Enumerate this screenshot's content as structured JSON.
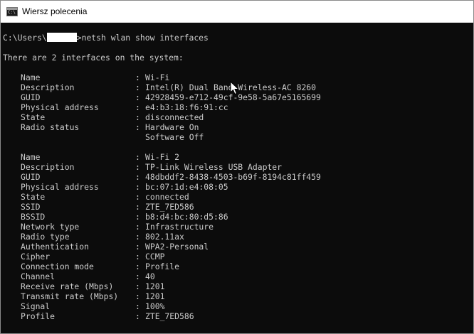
{
  "window": {
    "title": "Wiersz polecenia"
  },
  "prompt": {
    "prefix": "C:\\Users\\",
    "suffix": ">netsh wlan show interfaces"
  },
  "summary": "There are 2 interfaces on the system:",
  "interfaces": [
    {
      "rows": [
        {
          "key": "Name",
          "value": "Wi-Fi"
        },
        {
          "key": "Description",
          "value": "Intel(R) Dual Band Wireless-AC 8260"
        },
        {
          "key": "GUID",
          "value": "42928459-e712-49cf-9e58-5a67e5165699"
        },
        {
          "key": "Physical address",
          "value": "e4:b3:18:f6:91:cc"
        },
        {
          "key": "State",
          "value": "disconnected"
        },
        {
          "key": "Radio status",
          "value": "Hardware On"
        },
        {
          "key": "",
          "value": "Software Off"
        }
      ]
    },
    {
      "rows": [
        {
          "key": "Name",
          "value": "Wi-Fi 2"
        },
        {
          "key": "Description",
          "value": "TP-Link Wireless USB Adapter"
        },
        {
          "key": "GUID",
          "value": "48dbddf2-8438-4503-b69f-8194c81ff459"
        },
        {
          "key": "Physical address",
          "value": "bc:07:1d:e4:08:05"
        },
        {
          "key": "State",
          "value": "connected"
        },
        {
          "key": "SSID",
          "value": "ZTE_7ED586"
        },
        {
          "key": "BSSID",
          "value": "b8:d4:bc:80:d5:86"
        },
        {
          "key": "Network type",
          "value": "Infrastructure"
        },
        {
          "key": "Radio type",
          "value": "802.11ax"
        },
        {
          "key": "Authentication",
          "value": "WPA2-Personal"
        },
        {
          "key": "Cipher",
          "value": "CCMP"
        },
        {
          "key": "Connection mode",
          "value": "Profile"
        },
        {
          "key": "Channel",
          "value": "40"
        },
        {
          "key": "Receive rate (Mbps)",
          "value": "1201"
        },
        {
          "key": "Transmit rate (Mbps)",
          "value": "1201"
        },
        {
          "key": "Signal",
          "value": "100%"
        },
        {
          "key": "Profile",
          "value": "ZTE_7ED586"
        }
      ]
    }
  ]
}
